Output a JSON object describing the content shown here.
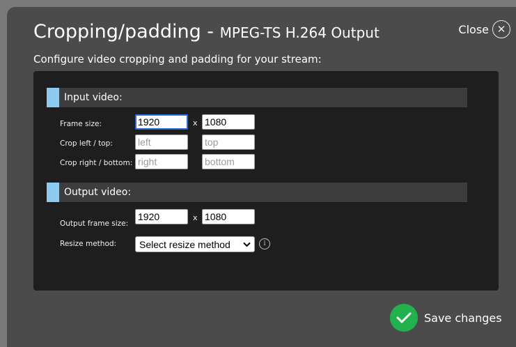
{
  "dialog": {
    "title_main": "Cropping/padding - ",
    "title_sub": "MPEG-TS H.264 Output",
    "subtitle": "Configure video cropping and padding for your stream:",
    "close_label": "Close",
    "close_glyph": "✕",
    "save_label": "Save changes"
  },
  "input_section": {
    "header": "Input video:",
    "frame_size_label": "Frame size:",
    "frame_width": "1920",
    "frame_height": "1080",
    "times": "x",
    "crop_left_top_label": "Crop left / top:",
    "crop_left_placeholder": "left",
    "crop_top_placeholder": "top",
    "crop_right_bottom_label": "Crop right / bottom:",
    "crop_right_placeholder": "right",
    "crop_bottom_placeholder": "bottom"
  },
  "output_section": {
    "header": "Output video:",
    "frame_size_label": "Output frame size:",
    "frame_width": "1920",
    "frame_height": "1080",
    "times": "x",
    "resize_label": "Resize method:",
    "resize_selected": "Select resize method",
    "info_glyph": "i"
  },
  "colors": {
    "backdrop": "#7a7a7a",
    "modal": "#4b4b4b",
    "panel": "#1e1e1e",
    "section_header": "#3d3d3d",
    "accent": "#8ec9ef",
    "save_green": "#23b14d"
  },
  "icons": {
    "close": "close-icon",
    "info": "info-icon",
    "save": "checkmark-icon",
    "select": "chevron-down-icon"
  }
}
